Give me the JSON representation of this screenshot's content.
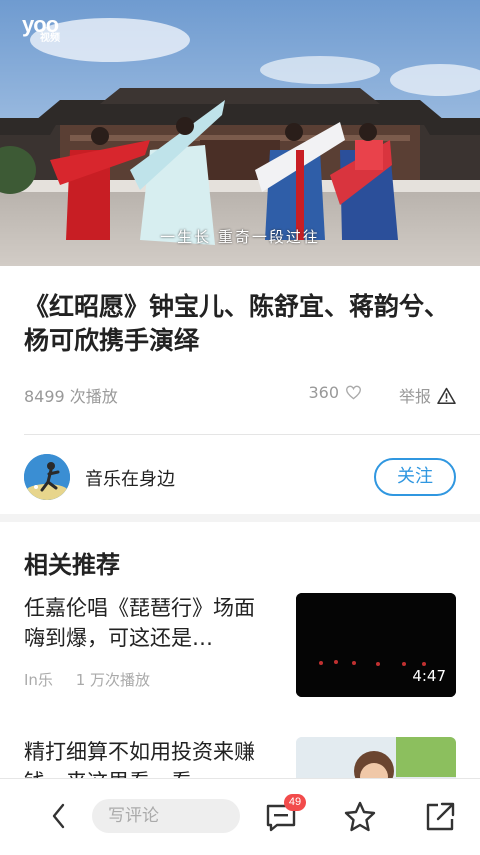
{
  "video": {
    "logo_main": "yoo",
    "logo_sub": "视频",
    "subtitle": "一生长 重奇一段过往"
  },
  "title": "《红昭愿》钟宝儿、陈舒宜、蒋韵兮、杨可欣携手演绎",
  "meta": {
    "plays": "8499 次播放",
    "likes": "360",
    "report": "举报"
  },
  "author": {
    "name": "音乐在身边",
    "follow_label": "关注"
  },
  "recommend": {
    "section_title": "相关推荐",
    "items": [
      {
        "title": "任嘉伦唱《琵琶行》场面嗨到爆，可这还是…",
        "source": "In乐",
        "plays": "1 万次播放",
        "duration": "4:47"
      },
      {
        "title": "精打细算不如用投资来赚钱，来这里看一看…",
        "source": "",
        "plays": "",
        "duration": ""
      }
    ]
  },
  "bottom_bar": {
    "comment_placeholder": "写评论",
    "comment_count": "49"
  },
  "colors": {
    "accent": "#3097e0",
    "badge": "#f24b4b"
  }
}
